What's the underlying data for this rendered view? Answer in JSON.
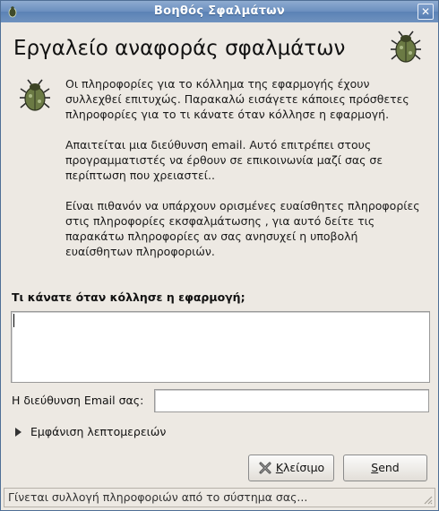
{
  "window": {
    "title": "Βοηθός Σφαλμάτων"
  },
  "header": {
    "title": "Εργαλείο αναφοράς σφαλμάτων"
  },
  "info": {
    "paragraph1": "Οι πληροφορίες για το κόλλημα της εφαρμογής έχουν συλλεχθεί επιτυχώς. Παρακαλώ εισάγετε κάποιες πρόσθετες πληροφορίες για το τι κάνατε όταν κόλλησε η εφαρμογή.",
    "paragraph2": "Απαιτείται μια διεύθυνση email. Αυτό επιτρέπει στους προγραμματιστές να έρθουν σε επικοινωνία μαζί σας σε περίπτωση που χρειαστεί..",
    "paragraph3": "Είναι πιθανόν να υπάρχουν ορισμένες ευαίσθητες πληροφορίες στις πληροφορίες εκσφαλμάτωσης , για αυτό δείτε τις παρακάτω πληροφορίες αν σας ανησυχεί η υποβολή ευαίσθητων πληροφοριών."
  },
  "form": {
    "what_label": "Τι κάνατε όταν κόλλησε η εφαρμογή;",
    "what_value": "",
    "email_label": "Η διεύθυνση Email σας:",
    "email_value": "",
    "details_expander": "Εμφάνιση λεπτομερειών"
  },
  "buttons": {
    "close_first": "Κ",
    "close_rest": "λείσιμο",
    "send_first": "S",
    "send_rest": "end"
  },
  "status": {
    "text": "Γίνεται συλλογή πληροφοριών από το σύστημα σας..."
  },
  "icons": {
    "app": "bug-icon",
    "close": "close-icon",
    "header": "bug-icon",
    "side": "bug-icon",
    "button_close": "close-x-icon"
  }
}
